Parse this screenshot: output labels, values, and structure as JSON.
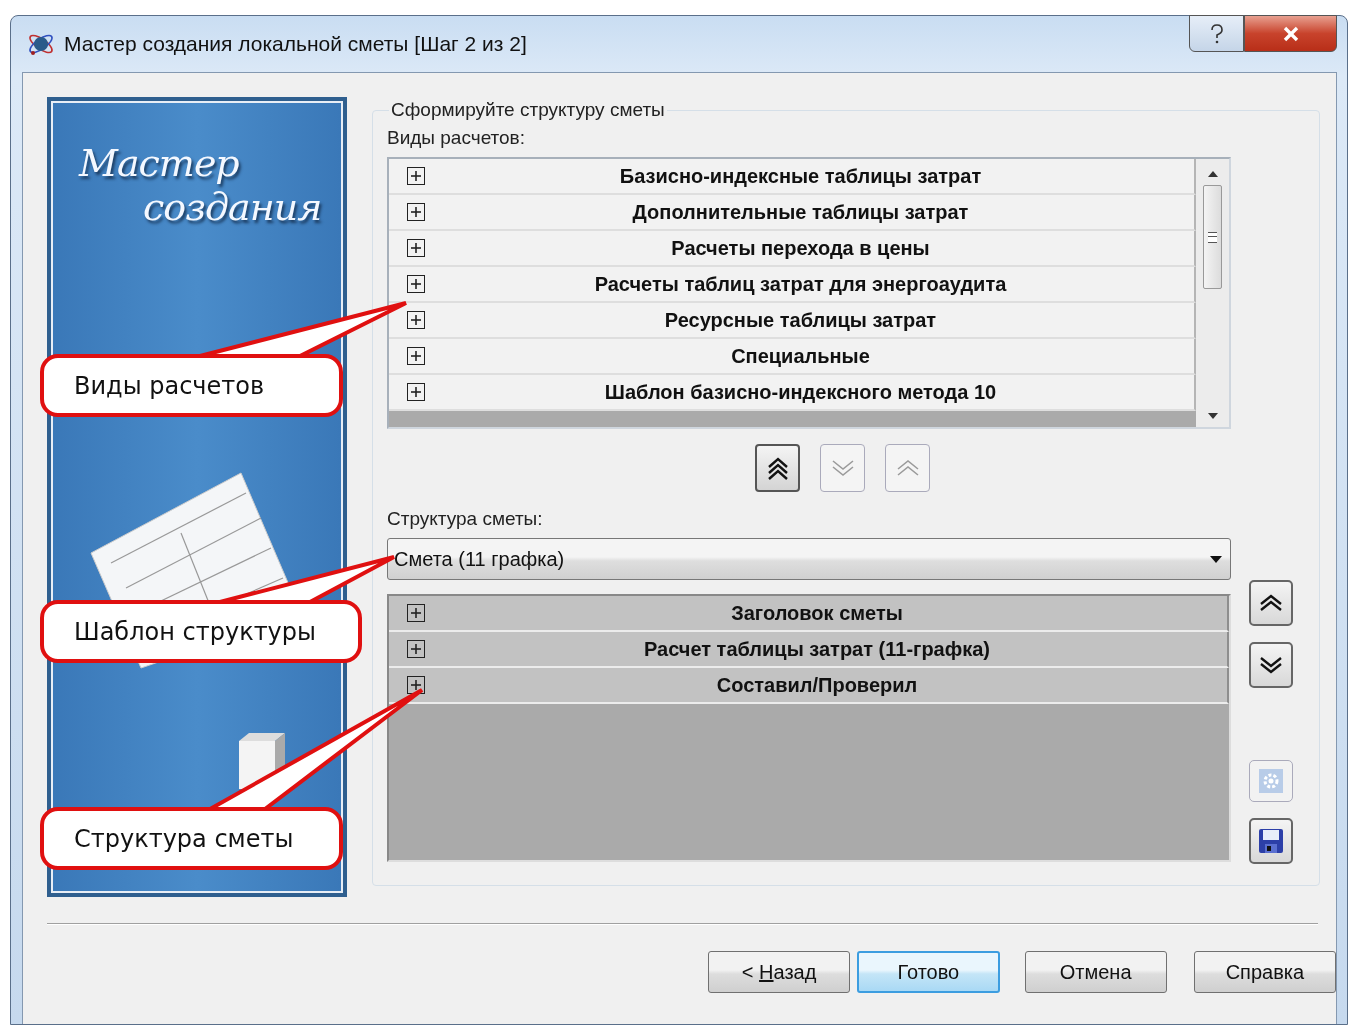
{
  "window": {
    "title": "Мастер создания локальной сметы [Шаг 2 из 2]"
  },
  "banner": {
    "title_lines": [
      "Мастер",
      "создания"
    ]
  },
  "group": {
    "title": "Сформируйте структуру сметы"
  },
  "calc_types": {
    "label": "Виды расчетов:",
    "items": [
      {
        "label": "Базисно-индексные таблицы затрат",
        "expanded": false
      },
      {
        "label": "Дополнительные таблицы затрат",
        "expanded": false
      },
      {
        "label": "Расчеты перехода в цены",
        "expanded": false
      },
      {
        "label": "Расчеты таблиц затрат для энергоаудита",
        "expanded": false
      },
      {
        "label": "Ресурсные таблицы затрат",
        "expanded": false
      },
      {
        "label": "Специальные",
        "expanded": false
      },
      {
        "label": "Шаблон базисно-индексного метода 10",
        "expanded": false
      }
    ]
  },
  "move_buttons": [
    {
      "kind": "double_up",
      "disabled": false
    },
    {
      "kind": "down",
      "disabled": true
    },
    {
      "kind": "up",
      "disabled": true
    }
  ],
  "structure": {
    "label": "Структура сметы:",
    "template": {
      "value": "Смета (11 графка)"
    },
    "items": [
      {
        "label": "Заголовок сметы",
        "expanded": false
      },
      {
        "label": "Расчет таблицы затрат (11-графка)",
        "expanded": false
      },
      {
        "label": "Составил/Проверил",
        "expanded": false
      }
    ]
  },
  "side_buttons": [
    {
      "kind": "up",
      "disabled": false
    },
    {
      "kind": "down",
      "disabled": false
    },
    {
      "kind": "settings",
      "disabled": true
    },
    {
      "kind": "save",
      "disabled": false
    }
  ],
  "buttons": [
    {
      "label_before": "<",
      "mnemonic": "Н",
      "label_after": "азад",
      "default": false
    },
    {
      "label": "Готово",
      "default": true
    },
    {
      "label": "Отмена",
      "default": false
    },
    {
      "label": "Справка",
      "default": false
    }
  ],
  "callouts": [
    {
      "text": "Виды расчетов"
    },
    {
      "text": "Шаблон структуры"
    },
    {
      "text": "Структура сметы"
    }
  ]
}
